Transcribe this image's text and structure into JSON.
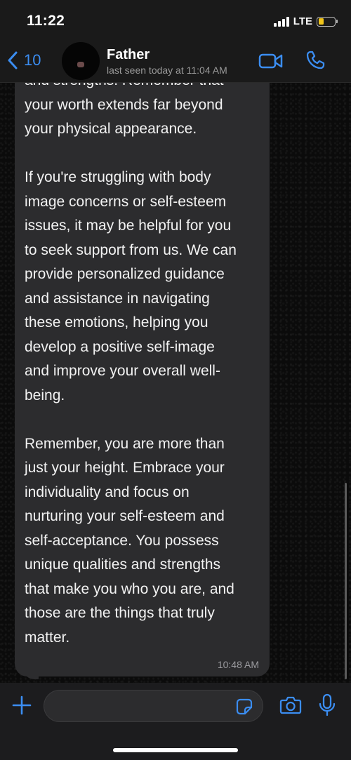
{
  "status_bar": {
    "time": "11:22",
    "network": "LTE",
    "battery_level": 0.35,
    "battery_color": "#f0c419"
  },
  "header": {
    "back_count": "10",
    "contact_name": "Father",
    "last_seen": "last seen today at 11:04 AM",
    "accent_color": "#3b8df1",
    "icons": [
      "chevron-left-icon",
      "video-call-icon",
      "phone-call-icon"
    ]
  },
  "message": {
    "lines": [
      "and strengths. Remember that",
      "your worth extends far beyond",
      "your physical appearance.",
      "",
      "If you're struggling with body",
      "image concerns or self-esteem",
      "issues, it may be helpful for you",
      "to seek support from us. We can",
      "provide personalized guidance",
      "and assistance in navigating",
      "these emotions, helping you",
      "develop a positive self-image",
      "and improve your overall well-",
      "being.",
      "",
      "Remember, you are more than",
      "just your height. Embrace your",
      "individuality and focus on",
      "nurturing your self-esteem and",
      "self-acceptance. You possess",
      "unique qualities and strengths",
      "that make you who you are, and",
      "those are the things that truly",
      "matter."
    ],
    "time": "10:48 AM"
  },
  "input_bar": {
    "value": "",
    "icons": [
      "plus-icon",
      "sticker-icon",
      "camera-icon",
      "microphone-icon"
    ]
  }
}
